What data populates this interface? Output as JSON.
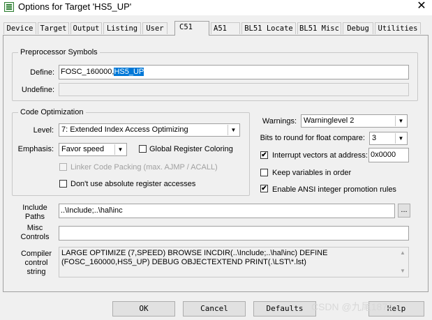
{
  "window": {
    "title": "Options for Target 'HS5_UP'",
    "close_glyph": "✕"
  },
  "tabs": [
    "Device",
    "Target",
    "Output",
    "Listing",
    "User",
    "C51",
    "A51",
    "BL51 Locate",
    "BL51 Misc",
    "Debug",
    "Utilities"
  ],
  "active_tab": "C51",
  "preprocessor": {
    "group_title": "Preprocessor Symbols",
    "define_label": "Define:",
    "define_value_plain": "FOSC_160000,",
    "define_value_selected": "HS5_UP",
    "undefine_label": "Undefine:",
    "undefine_value": ""
  },
  "code_opt": {
    "group_title": "Code Optimization",
    "level_label": "Level:",
    "level_value": "7: Extended Index Access Optimizing",
    "emphasis_label": "Emphasis:",
    "emphasis_value": "Favor speed",
    "global_reg_label": "Global Register Coloring",
    "global_reg_checked": false,
    "linker_pack_label": "Linker Code Packing (max. AJMP / ACALL)",
    "linker_pack_checked": false,
    "no_abs_label": "Don't use absolute register accesses",
    "no_abs_checked": false
  },
  "right_opts": {
    "warnings_label": "Warnings:",
    "warnings_value": "Warninglevel 2",
    "bits_label": "Bits to round for float compare:",
    "bits_value": "3",
    "interrupt_label": "Interrupt vectors at address:",
    "interrupt_checked": true,
    "interrupt_value": "0x0000",
    "keep_vars_label": "Keep variables in order",
    "keep_vars_checked": false,
    "ansi_label": "Enable ANSI integer promotion rules",
    "ansi_checked": true
  },
  "paths": {
    "include_label": "Include\nPaths",
    "include_value": "..\\Include;..\\hal\\inc",
    "browse_label": "...",
    "misc_label": "Misc\nControls",
    "misc_value": ""
  },
  "compiler": {
    "label": "Compiler\ncontrol\nstring",
    "value": "LARGE OPTIMIZE (7,SPEED) BROWSE INCDIR(..\\Include;..\\hal\\inc) DEFINE (FOSC_160000,HS5_UP) DEBUG OBJECTEXTEND PRINT(.\\LST\\*.lst)"
  },
  "buttons": {
    "ok": "OK",
    "cancel": "Cancel",
    "defaults": "Defaults",
    "help": "Help"
  },
  "watermark": "CSDN @九尾1874",
  "checkmark_glyph": "✔",
  "arrow_glyph": "▼"
}
